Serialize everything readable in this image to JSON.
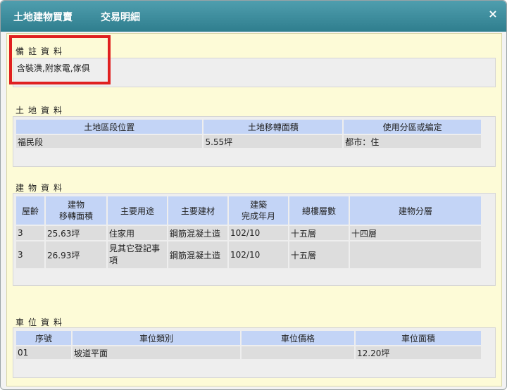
{
  "dialog": {
    "title_main": "土地建物買賣",
    "title_tab": "交易明細",
    "close_glyph": "×"
  },
  "remarks": {
    "label": "備註資料",
    "text": "含裝潢,附家電,傢俱"
  },
  "land": {
    "label": "土地資料",
    "headers": [
      "土地區段位置",
      "土地移轉面積",
      "使用分區或編定"
    ],
    "rows": [
      [
        "福民段",
        "5.55坪",
        "都市：住"
      ]
    ]
  },
  "building": {
    "label": "建物資料",
    "headers": [
      "屋齡",
      "建物\n移轉面積",
      "主要用途",
      "主要建材",
      "建築\n完成年月",
      "總樓層數",
      "建物分層"
    ],
    "rows": [
      [
        "3",
        "25.63坪",
        "住家用",
        "鋼筋混凝土造",
        "102/10",
        "十五層",
        "十四層"
      ],
      [
        "3",
        "26.93坪",
        "見其它登記事項",
        "鋼筋混凝土造",
        "102/10",
        "十五層",
        ""
      ]
    ]
  },
  "parking": {
    "label": "車位資料",
    "headers": [
      "序號",
      "車位類別",
      "車位價格",
      "車位面積"
    ],
    "rows": [
      [
        "01",
        "坡道平面",
        "",
        "12.20坪"
      ]
    ]
  },
  "colors": {
    "title_bar": "#3a8a9a",
    "content_bg": "#fdfbd7",
    "header_bg": "#c3d4f6",
    "highlight": "#e02020"
  }
}
